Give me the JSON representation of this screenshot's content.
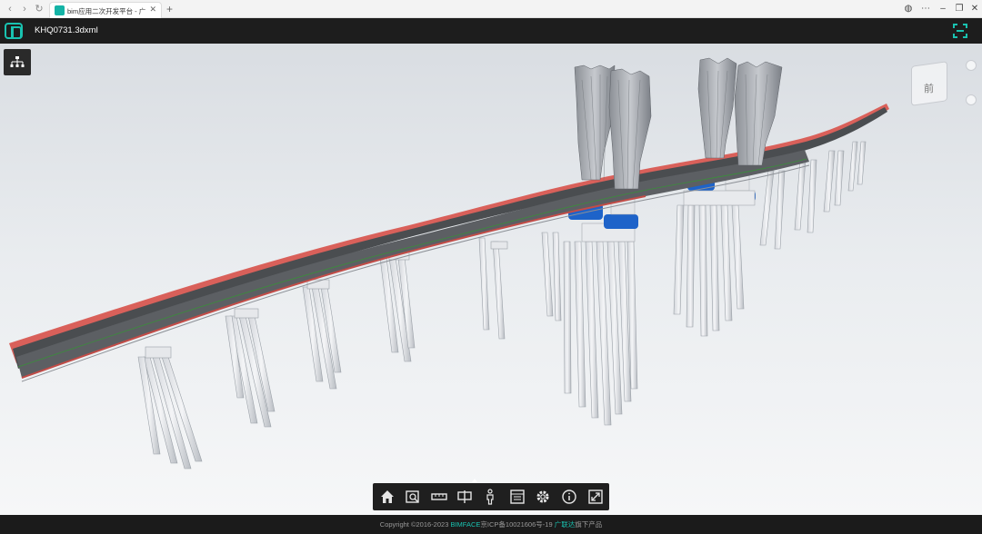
{
  "browser": {
    "back_icon": "chevron-left-icon",
    "forward_icon": "chevron-right-icon",
    "reload_icon": "reload-icon",
    "tab_title": "bim应用二次开发平台 - 广联",
    "tab_close": "✕",
    "new_tab": "+",
    "window_controls": [
      "globe-icon",
      "more-icon",
      "minimize-icon",
      "restore-icon",
      "close-icon"
    ]
  },
  "header": {
    "app_logo": "bimface-logo",
    "file_name": "KHQ0731.3dxml",
    "fullscreen_icon": "fullscreen-frame-icon"
  },
  "viewport": {
    "tree_button_icon": "model-tree-icon",
    "viewcube_label": "前",
    "accent_color": "#19c2b0",
    "bearing_color": "#1e63c9",
    "deck_edge_color": "#d9605a"
  },
  "toolbar": {
    "tools": [
      "home-icon",
      "zoom-area-icon",
      "measure-icon",
      "section-icon",
      "walk-person-icon",
      "property-list-icon",
      "settings-gear-icon",
      "info-icon",
      "fullscreen-expand-icon"
    ]
  },
  "footer": {
    "copyright": "Copyright ©2016-2023 ",
    "brand": "BIMFACE",
    "icp": "京ICP备10021606号-19 ",
    "company": "广联达",
    "suffix": "旗下产品"
  }
}
